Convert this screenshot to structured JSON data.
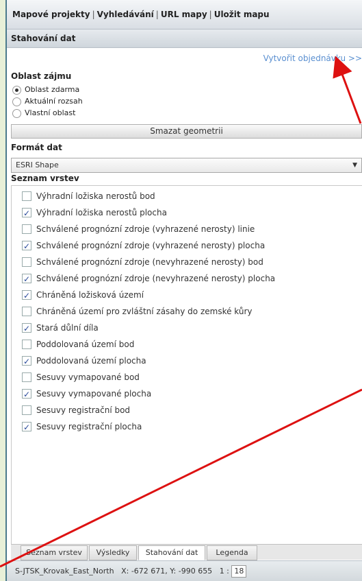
{
  "menu": {
    "items": [
      "Mapové projekty",
      "Vyhledávání",
      "URL mapy",
      "Uložit mapu"
    ],
    "separator": "|"
  },
  "panel": {
    "title": "Stahování dat"
  },
  "order_link": "Vytvořit objednávku >>",
  "area": {
    "title": "Oblast zájmu",
    "options": [
      {
        "label": "Oblast zdarma",
        "selected": true
      },
      {
        "label": "Aktuální rozsah",
        "selected": false
      },
      {
        "label": "Vlastní oblast",
        "selected": false
      }
    ],
    "clear_button": "Smazat geometrii"
  },
  "format": {
    "title": "Formát dat",
    "selected": "ESRI Shape"
  },
  "layers": {
    "title": "Seznam vrstev",
    "items": [
      {
        "label": "Výhradní ložiska nerostů bod",
        "checked": false
      },
      {
        "label": "Výhradní ložiska nerostů plocha",
        "checked": true
      },
      {
        "label": "Schválené prognózní zdroje (vyhrazené nerosty) linie",
        "checked": false
      },
      {
        "label": "Schválené prognózní zdroje (vyhrazené nerosty) plocha",
        "checked": true
      },
      {
        "label": "Schválené prognózní zdroje (nevyhrazené nerosty) bod",
        "checked": false
      },
      {
        "label": "Schválené prognózní zdroje (nevyhrazené nerosty) plocha",
        "checked": true
      },
      {
        "label": "Chráněná ložisková území",
        "checked": true
      },
      {
        "label": "Chráněná území pro zvláštní zásahy do zemské kůry",
        "checked": false
      },
      {
        "label": "Stará důlní díla",
        "checked": true
      },
      {
        "label": "Poddolovaná území bod",
        "checked": false
      },
      {
        "label": "Poddolovaná území plocha",
        "checked": true
      },
      {
        "label": "Sesuvy vymapované bod",
        "checked": false
      },
      {
        "label": "Sesuvy vymapované plocha",
        "checked": true
      },
      {
        "label": "Sesuvy registrační bod",
        "checked": false
      },
      {
        "label": "Sesuvy registrační plocha",
        "checked": true
      }
    ]
  },
  "tabs": [
    {
      "label": "Seznam vrstev",
      "active": false
    },
    {
      "label": "Výsledky",
      "active": false
    },
    {
      "label": "Stahování dat",
      "active": true
    },
    {
      "label": "Legenda",
      "active": false
    }
  ],
  "status": {
    "crs": "S-JTSK_Krovak_East_North",
    "coords": "X: -672 671, Y: -990 655",
    "scale_prefix": "1 :",
    "scale_value": "18"
  },
  "colors": {
    "annotation_arrow": "#dd1111",
    "link": "#5a8fd0"
  }
}
